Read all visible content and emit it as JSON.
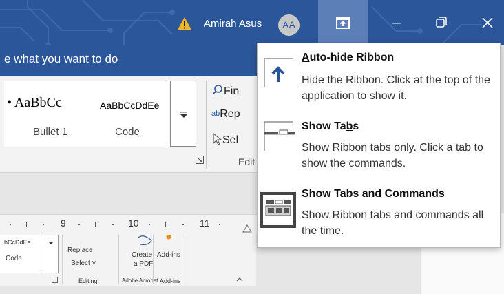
{
  "titlebar": {
    "user_name": "Amirah Asus",
    "avatar_initials": "AA",
    "accent_color": "#2b579a"
  },
  "tell_me": {
    "text": "e what you want to do"
  },
  "styles_gallery": {
    "sample_1": "• AaBbCc",
    "sample_1_prefix": "•",
    "sample_2": "AaBbCcDdEe",
    "style_1_label": "Bullet 1",
    "style_2_label": "Code"
  },
  "editing_group": {
    "find": "Fin",
    "replace": "Rep",
    "select": "Sel",
    "label": "Edit"
  },
  "ruler": {
    "labels": [
      "9",
      "10",
      "11"
    ]
  },
  "mini_ribbon": {
    "style_sample": "bCcDdEe",
    "style_label": "Code",
    "replace": "Replace",
    "select": "Select ˅",
    "create_pdf_line1": "Create",
    "create_pdf_line2": "a PDF",
    "addins": "Add-ins",
    "group_editing": "Editing",
    "group_adobe": "Adobe Acrobat",
    "group_addins": "Add-ins"
  },
  "ribbon_display_options": {
    "items": [
      {
        "title_pre": "",
        "title_key": "A",
        "title_post": "uto-hide Ribbon",
        "description": "Hide the Ribbon. Click at the top of the application to show it.",
        "icon": "auto-hide-ribbon-icon"
      },
      {
        "title_pre": "Show Ta",
        "title_key": "b",
        "title_post": "s",
        "description": "Show Ribbon tabs only. Click a tab to show the commands.",
        "icon": "show-tabs-icon"
      },
      {
        "title_pre": "Show Tabs and C",
        "title_key": "o",
        "title_post": "mmands",
        "description": "Show Ribbon tabs and commands all the time.",
        "icon": "show-tabs-commands-icon",
        "selected": true
      }
    ]
  }
}
